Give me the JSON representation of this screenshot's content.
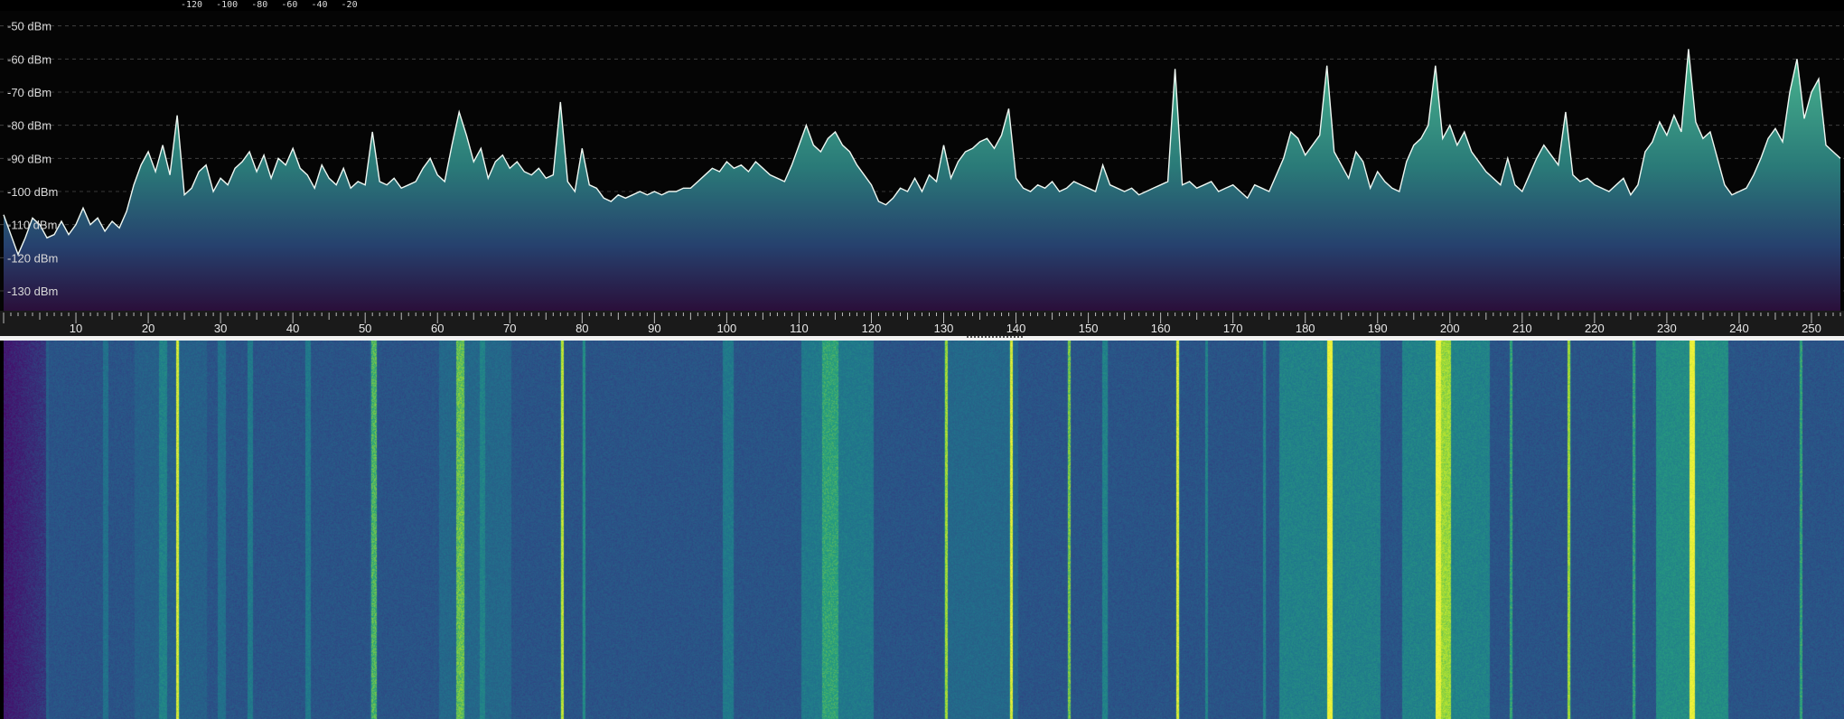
{
  "window": {
    "top_scale_labels": [
      "-120",
      "-100",
      "-80",
      "-60",
      "-40",
      "-20"
    ]
  },
  "spectrum": {
    "y_axis_labels": [
      "-50 dBm",
      "-60 dBm",
      "-70 dBm",
      "-80 dBm",
      "-90 dBm",
      "-100 dBm",
      "-110 dBm",
      "-120 dBm",
      "-130 dBm"
    ],
    "y_axis_values": [
      -50,
      -60,
      -70,
      -80,
      -90,
      -100,
      -110,
      -120,
      -130
    ],
    "y_range": [
      -46,
      -136
    ],
    "x_range": [
      0,
      254
    ],
    "x_tick_labels": [
      "10",
      "20",
      "30",
      "40",
      "50",
      "60",
      "70",
      "80",
      "90",
      "100",
      "110",
      "120",
      "130",
      "140",
      "150",
      "160",
      "170",
      "180",
      "190",
      "200",
      "210",
      "220",
      "230",
      "240",
      "250"
    ],
    "x_tick_values": [
      10,
      20,
      30,
      40,
      50,
      60,
      70,
      80,
      90,
      100,
      110,
      120,
      130,
      140,
      150,
      160,
      170,
      180,
      190,
      200,
      210,
      220,
      230,
      240,
      250
    ],
    "grid": true,
    "colors": {
      "trace": "#e8f4ee",
      "fill_top": "#3aa884",
      "fill_bottom": "#2a0f3a",
      "grid": "#555555"
    },
    "trace_points": [
      [
        0,
        -107
      ],
      [
        1,
        -113
      ],
      [
        2,
        -119
      ],
      [
        3,
        -114
      ],
      [
        4,
        -108
      ],
      [
        5,
        -110
      ],
      [
        6,
        -114
      ],
      [
        7,
        -113
      ],
      [
        8,
        -109
      ],
      [
        9,
        -113
      ],
      [
        10,
        -110
      ],
      [
        11,
        -105
      ],
      [
        12,
        -110
      ],
      [
        13,
        -108
      ],
      [
        14,
        -112
      ],
      [
        15,
        -109
      ],
      [
        16,
        -111
      ],
      [
        17,
        -106
      ],
      [
        18,
        -98
      ],
      [
        19,
        -92
      ],
      [
        20,
        -88
      ],
      [
        21,
        -94
      ],
      [
        22,
        -86
      ],
      [
        23,
        -95
      ],
      [
        24,
        -77
      ],
      [
        25,
        -101
      ],
      [
        26,
        -99
      ],
      [
        27,
        -94
      ],
      [
        28,
        -92
      ],
      [
        29,
        -100
      ],
      [
        30,
        -96
      ],
      [
        31,
        -98
      ],
      [
        32,
        -93
      ],
      [
        33,
        -91
      ],
      [
        34,
        -88
      ],
      [
        35,
        -94
      ],
      [
        36,
        -89
      ],
      [
        37,
        -96
      ],
      [
        38,
        -90
      ],
      [
        39,
        -92
      ],
      [
        40,
        -87
      ],
      [
        41,
        -93
      ],
      [
        42,
        -95
      ],
      [
        43,
        -99
      ],
      [
        44,
        -92
      ],
      [
        45,
        -96
      ],
      [
        46,
        -98
      ],
      [
        47,
        -93
      ],
      [
        48,
        -99
      ],
      [
        49,
        -97
      ],
      [
        50,
        -98
      ],
      [
        51,
        -82
      ],
      [
        52,
        -97
      ],
      [
        53,
        -98
      ],
      [
        54,
        -96
      ],
      [
        55,
        -99
      ],
      [
        56,
        -98
      ],
      [
        57,
        -97
      ],
      [
        58,
        -93
      ],
      [
        59,
        -90
      ],
      [
        60,
        -95
      ],
      [
        61,
        -97
      ],
      [
        62,
        -86
      ],
      [
        63,
        -76
      ],
      [
        64,
        -83
      ],
      [
        65,
        -91
      ],
      [
        66,
        -87
      ],
      [
        67,
        -96
      ],
      [
        68,
        -91
      ],
      [
        69,
        -89
      ],
      [
        70,
        -93
      ],
      [
        71,
        -91
      ],
      [
        72,
        -94
      ],
      [
        73,
        -95
      ],
      [
        74,
        -93
      ],
      [
        75,
        -96
      ],
      [
        76,
        -95
      ],
      [
        77,
        -73
      ],
      [
        78,
        -97
      ],
      [
        79,
        -100
      ],
      [
        80,
        -87
      ],
      [
        81,
        -98
      ],
      [
        82,
        -99
      ],
      [
        83,
        -102
      ],
      [
        84,
        -103
      ],
      [
        85,
        -101
      ],
      [
        86,
        -102
      ],
      [
        87,
        -101
      ],
      [
        88,
        -100
      ],
      [
        89,
        -101
      ],
      [
        90,
        -100
      ],
      [
        91,
        -101
      ],
      [
        92,
        -100
      ],
      [
        93,
        -100
      ],
      [
        94,
        -99
      ],
      [
        95,
        -99
      ],
      [
        96,
        -97
      ],
      [
        97,
        -95
      ],
      [
        98,
        -93
      ],
      [
        99,
        -94
      ],
      [
        100,
        -91
      ],
      [
        101,
        -93
      ],
      [
        102,
        -92
      ],
      [
        103,
        -94
      ],
      [
        104,
        -91
      ],
      [
        105,
        -93
      ],
      [
        106,
        -95
      ],
      [
        107,
        -96
      ],
      [
        108,
        -97
      ],
      [
        109,
        -92
      ],
      [
        110,
        -86
      ],
      [
        111,
        -80
      ],
      [
        112,
        -86
      ],
      [
        113,
        -88
      ],
      [
        114,
        -84
      ],
      [
        115,
        -82
      ],
      [
        116,
        -86
      ],
      [
        117,
        -88
      ],
      [
        118,
        -92
      ],
      [
        119,
        -95
      ],
      [
        120,
        -98
      ],
      [
        121,
        -103
      ],
      [
        122,
        -104
      ],
      [
        123,
        -102
      ],
      [
        124,
        -99
      ],
      [
        125,
        -100
      ],
      [
        126,
        -96
      ],
      [
        127,
        -100
      ],
      [
        128,
        -95
      ],
      [
        129,
        -97
      ],
      [
        130,
        -86
      ],
      [
        131,
        -96
      ],
      [
        132,
        -91
      ],
      [
        133,
        -88
      ],
      [
        134,
        -87
      ],
      [
        135,
        -85
      ],
      [
        136,
        -84
      ],
      [
        137,
        -87
      ],
      [
        138,
        -83
      ],
      [
        139,
        -75
      ],
      [
        140,
        -96
      ],
      [
        141,
        -99
      ],
      [
        142,
        -100
      ],
      [
        143,
        -98
      ],
      [
        144,
        -99
      ],
      [
        145,
        -97
      ],
      [
        146,
        -100
      ],
      [
        147,
        -99
      ],
      [
        148,
        -97
      ],
      [
        149,
        -98
      ],
      [
        150,
        -99
      ],
      [
        151,
        -100
      ],
      [
        152,
        -92
      ],
      [
        153,
        -98
      ],
      [
        154,
        -99
      ],
      [
        155,
        -100
      ],
      [
        156,
        -99
      ],
      [
        157,
        -101
      ],
      [
        158,
        -100
      ],
      [
        159,
        -99
      ],
      [
        160,
        -98
      ],
      [
        161,
        -97
      ],
      [
        162,
        -63
      ],
      [
        163,
        -98
      ],
      [
        164,
        -97
      ],
      [
        165,
        -99
      ],
      [
        166,
        -98
      ],
      [
        167,
        -97
      ],
      [
        168,
        -100
      ],
      [
        169,
        -99
      ],
      [
        170,
        -98
      ],
      [
        171,
        -100
      ],
      [
        172,
        -102
      ],
      [
        173,
        -98
      ],
      [
        174,
        -99
      ],
      [
        175,
        -100
      ],
      [
        176,
        -95
      ],
      [
        177,
        -90
      ],
      [
        178,
        -82
      ],
      [
        179,
        -84
      ],
      [
        180,
        -89
      ],
      [
        181,
        -86
      ],
      [
        182,
        -83
      ],
      [
        183,
        -62
      ],
      [
        184,
        -88
      ],
      [
        185,
        -92
      ],
      [
        186,
        -96
      ],
      [
        187,
        -88
      ],
      [
        188,
        -91
      ],
      [
        189,
        -99
      ],
      [
        190,
        -94
      ],
      [
        191,
        -97
      ],
      [
        192,
        -99
      ],
      [
        193,
        -100
      ],
      [
        194,
        -91
      ],
      [
        195,
        -86
      ],
      [
        196,
        -84
      ],
      [
        197,
        -80
      ],
      [
        198,
        -62
      ],
      [
        199,
        -84
      ],
      [
        200,
        -80
      ],
      [
        201,
        -86
      ],
      [
        202,
        -82
      ],
      [
        203,
        -88
      ],
      [
        204,
        -91
      ],
      [
        205,
        -94
      ],
      [
        206,
        -96
      ],
      [
        207,
        -98
      ],
      [
        208,
        -90
      ],
      [
        209,
        -98
      ],
      [
        210,
        -100
      ],
      [
        211,
        -95
      ],
      [
        212,
        -90
      ],
      [
        213,
        -86
      ],
      [
        214,
        -89
      ],
      [
        215,
        -92
      ],
      [
        216,
        -76
      ],
      [
        217,
        -95
      ],
      [
        218,
        -97
      ],
      [
        219,
        -96
      ],
      [
        220,
        -98
      ],
      [
        221,
        -99
      ],
      [
        222,
        -100
      ],
      [
        223,
        -98
      ],
      [
        224,
        -96
      ],
      [
        225,
        -101
      ],
      [
        226,
        -98
      ],
      [
        227,
        -88
      ],
      [
        228,
        -85
      ],
      [
        229,
        -79
      ],
      [
        230,
        -83
      ],
      [
        231,
        -77
      ],
      [
        232,
        -82
      ],
      [
        233,
        -57
      ],
      [
        234,
        -79
      ],
      [
        235,
        -84
      ],
      [
        236,
        -82
      ],
      [
        237,
        -90
      ],
      [
        238,
        -98
      ],
      [
        239,
        -101
      ],
      [
        240,
        -100
      ],
      [
        241,
        -99
      ],
      [
        242,
        -95
      ],
      [
        243,
        -90
      ],
      [
        244,
        -84
      ],
      [
        245,
        -81
      ],
      [
        246,
        -85
      ],
      [
        247,
        -70
      ],
      [
        248,
        -60
      ],
      [
        249,
        -78
      ],
      [
        250,
        -70
      ],
      [
        251,
        -66
      ],
      [
        252,
        -86
      ],
      [
        253,
        -88
      ],
      [
        254,
        -90
      ]
    ]
  },
  "waterfall": {
    "colors": {
      "floor": "#2b4f86",
      "edge": "#4a0f70",
      "mid": "#26888f",
      "bright": "#b7e32a",
      "peak": "#f1f23a"
    },
    "columns": [
      {
        "freq": 6,
        "level": 0.35,
        "width": 1
      },
      {
        "freq": 14,
        "level": 0.45,
        "width": 2
      },
      {
        "freq": 22,
        "level": 0.55,
        "width": 3
      },
      {
        "freq": 24,
        "level": 0.95,
        "width": 1
      },
      {
        "freq": 30,
        "level": 0.45,
        "width": 3
      },
      {
        "freq": 34,
        "level": 0.5,
        "width": 2
      },
      {
        "freq": 42,
        "level": 0.5,
        "width": 2
      },
      {
        "freq": 51,
        "level": 0.75,
        "width": 2
      },
      {
        "freq": 63,
        "level": 0.78,
        "width": 3
      },
      {
        "freq": 66,
        "level": 0.55,
        "width": 2
      },
      {
        "freq": 77,
        "level": 0.9,
        "width": 1
      },
      {
        "freq": 80,
        "level": 0.6,
        "width": 1
      },
      {
        "freq": 100,
        "level": 0.5,
        "width": 4
      },
      {
        "freq": 114,
        "level": 0.7,
        "width": 6
      },
      {
        "freq": 130,
        "level": 0.85,
        "width": 1
      },
      {
        "freq": 139,
        "level": 0.95,
        "width": 1
      },
      {
        "freq": 147,
        "level": 0.8,
        "width": 1
      },
      {
        "freq": 152,
        "level": 0.55,
        "width": 2
      },
      {
        "freq": 162,
        "level": 0.95,
        "width": 1
      },
      {
        "freq": 166,
        "level": 0.55,
        "width": 1
      },
      {
        "freq": 174,
        "level": 0.55,
        "width": 1
      },
      {
        "freq": 183,
        "level": 1.0,
        "width": 2
      },
      {
        "freq": 198,
        "level": 1.0,
        "width": 2
      },
      {
        "freq": 199,
        "level": 0.85,
        "width": 4
      },
      {
        "freq": 208,
        "level": 0.7,
        "width": 1
      },
      {
        "freq": 216,
        "level": 0.85,
        "width": 1
      },
      {
        "freq": 225,
        "level": 0.7,
        "width": 1
      },
      {
        "freq": 233,
        "level": 1.0,
        "width": 2
      },
      {
        "freq": 248,
        "level": 0.7,
        "width": 1
      }
    ],
    "bands": [
      {
        "from": 0,
        "to": 6,
        "level": 0.05
      },
      {
        "from": 18,
        "to": 28,
        "level": 0.35
      },
      {
        "from": 60,
        "to": 70,
        "level": 0.4
      },
      {
        "from": 110,
        "to": 120,
        "level": 0.5
      },
      {
        "from": 130,
        "to": 140,
        "level": 0.4
      },
      {
        "from": 176,
        "to": 190,
        "level": 0.55
      },
      {
        "from": 193,
        "to": 205,
        "level": 0.55
      },
      {
        "from": 228,
        "to": 238,
        "level": 0.6
      }
    ]
  }
}
